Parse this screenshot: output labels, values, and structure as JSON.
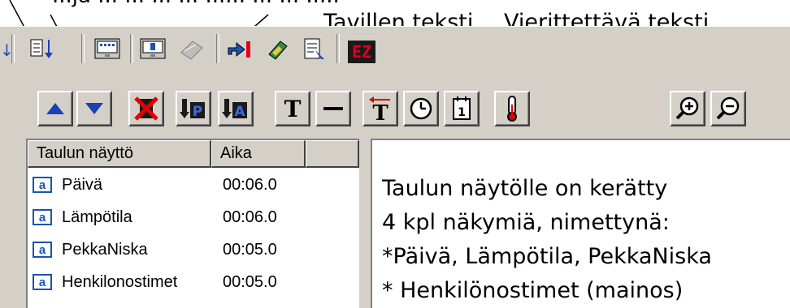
{
  "annotations": {
    "top_partial": "...ja ... ... ...  ... ...... ... ... .....",
    "table_text": "Tavillen teksti",
    "scroll_text": "Vierittettävä teksti"
  },
  "toolbar_icons": [
    "sort-down-icon",
    "display-icon",
    "display-2-icon",
    "eraser-icon",
    "export-icon",
    "edit-icon",
    "document-icon",
    "ez-icon"
  ],
  "ez_label": "EZ",
  "buttons": {
    "up": "move-up",
    "down": "move-down",
    "delete": "delete",
    "p_label": "P",
    "a_label": "A",
    "text_label": "T",
    "line_label": "—",
    "scroll_text_label": "T",
    "calendar_label": "1"
  },
  "list": {
    "columns": [
      "Taulun näyttö",
      "Aika"
    ],
    "rows": [
      {
        "name": "Päivä",
        "time": "00:06.0"
      },
      {
        "name": "Lämpötila",
        "time": "00:06.0"
      },
      {
        "name": "PekkaNiska",
        "time": "00:05.0"
      },
      {
        "name": "Henkilonostimet",
        "time": "00:05.0"
      }
    ],
    "row_icon_letter": "a"
  },
  "preview": {
    "lines": [
      "Taulun näytölle on kerätty",
      "4 kpl näkymiä, nimettynä:",
      "*Päivä, Lämpötila, PekkaNiska",
      "* Henkilönostimet (mainos)"
    ]
  },
  "colors": {
    "face": "#d4d0c8",
    "arrow_blue": "#1b3fb5",
    "icon_blue": "#1b52b5",
    "ez_red": "#e0001a",
    "delete_red": "#e00000"
  }
}
